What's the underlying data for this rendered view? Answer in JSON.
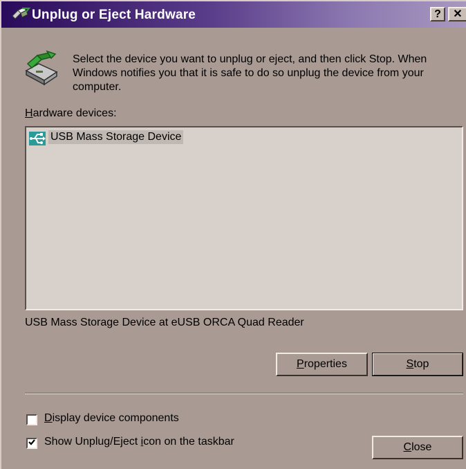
{
  "window": {
    "title": "Unplug or Eject Hardware",
    "help_label": "?",
    "close_label": "✕",
    "title_gradient_start": "#2a0a5a",
    "title_gradient_end": "#a898c0"
  },
  "intro": {
    "text": "Select the device you want to unplug or eject, and then click Stop. When Windows notifies you that it is safe to do so unplug the device from your computer."
  },
  "hardware": {
    "label": "Hardware devices:",
    "items": [
      {
        "label": "USB Mass Storage Device",
        "icon": "usb-device-icon",
        "selected": true
      }
    ],
    "status": "USB Mass Storage Device at eUSB ORCA Quad Reader"
  },
  "buttons": {
    "properties": "Properties",
    "stop": "Stop",
    "close": "Close"
  },
  "options": {
    "display_components": {
      "label": "Display device components",
      "checked": false
    },
    "show_icon": {
      "label": "Show Unplug/Eject icon on the taskbar",
      "checked": true
    }
  }
}
